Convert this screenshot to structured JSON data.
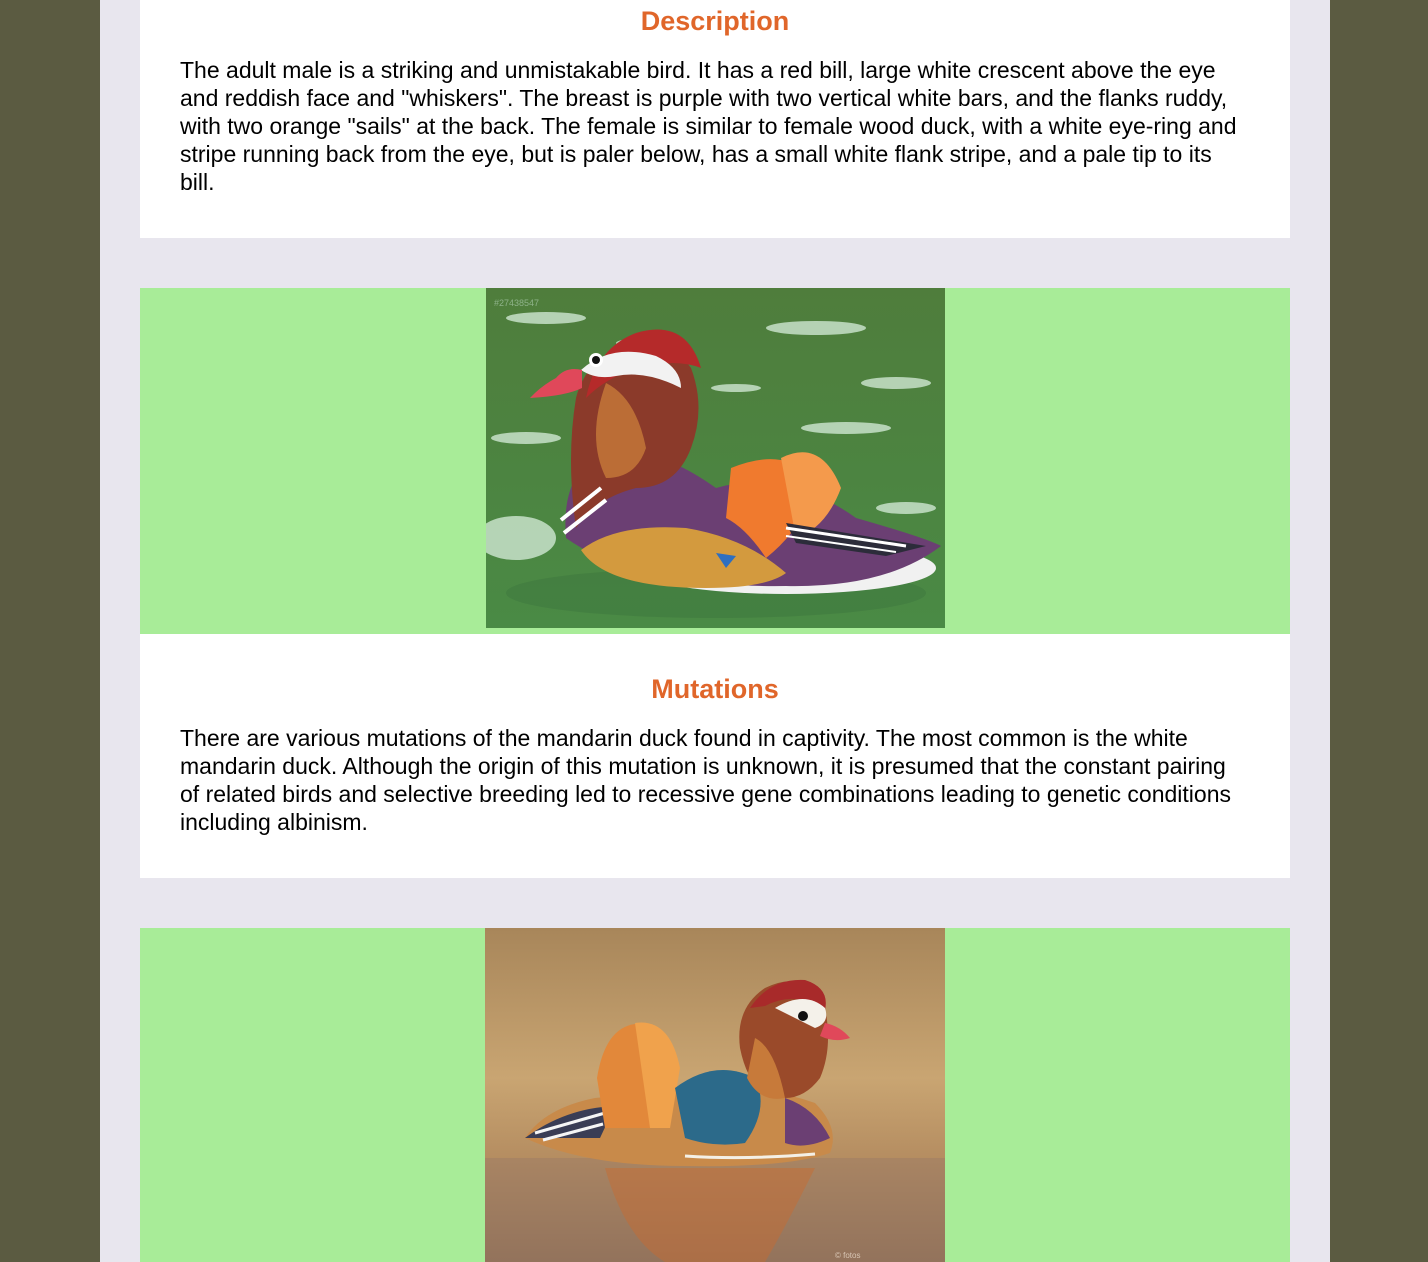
{
  "sections": [
    {
      "heading": "Description",
      "body": "The adult male is a striking and unmistakable bird. It has a red bill, large white crescent above the eye and reddish face and \"whiskers\". The breast is purple with two vertical white bars, and the flanks ruddy, with two orange \"sails\" at the back. The female is similar to female wood duck, with a white eye-ring and stripe running back from the eye, but is paler below, has a small white flank stripe, and a pale tip to its bill."
    },
    {
      "heading": "Mutations",
      "body": "There are various mutations of the mandarin duck found in captivity. The most common is the white mandarin duck. Although the origin of this mutation is unknown, it is presumed that the constant pairing of related birds and selective breeding led to recessive gene combinations leading to genetic conditions including albinism."
    }
  ],
  "colors": {
    "outer_background": "#5b5b41",
    "page_background": "#e8e6ee",
    "heading": "#e0662a",
    "image_band": "#a8ec98"
  }
}
